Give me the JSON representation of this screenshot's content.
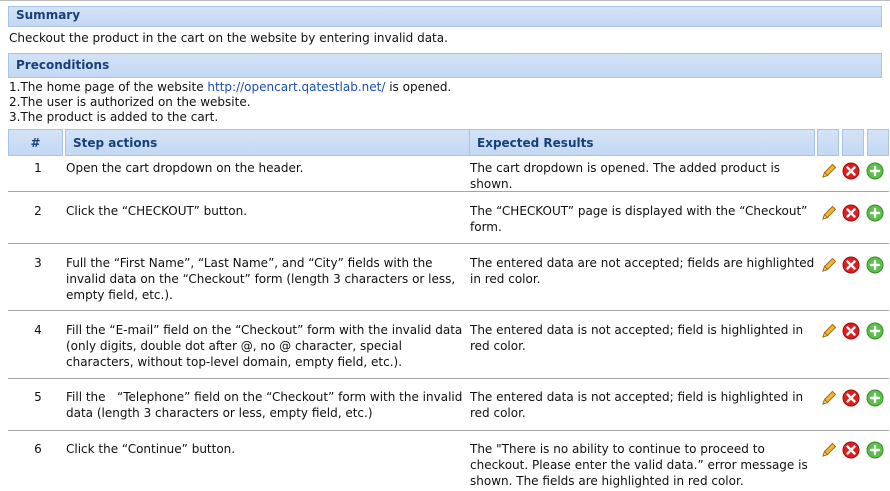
{
  "summary": {
    "heading": "Summary",
    "text": "Checkout the product in the cart on the website by entering invalid data."
  },
  "preconditions": {
    "heading": "Preconditions",
    "line1_prefix": "1.The home page of the website ",
    "line1_link": "http://opencart.qatestlab.net/",
    "line1_suffix": " is opened.",
    "line2": "2.The user is authorized on the website.",
    "line3": "3.The product is added to the cart."
  },
  "steps_table": {
    "col_num": "#",
    "col_actions": "Step actions",
    "col_expected": "Expected Results",
    "rows": [
      {
        "num": "1",
        "action": "Open the cart dropdown on the header.",
        "expected": "The cart dropdown is opened. The added product is shown."
      },
      {
        "num": "2",
        "action": "Click the “CHECKOUT” button.",
        "expected": "The “CHECKOUT” page is displayed with the “Checkout” form."
      },
      {
        "num": "3",
        "action": "Full the “First Name”, “Last Name”, and “City” fields with the invalid data on the “Checkout” form (length 3 characters or less, empty field, etc.).",
        "expected": "The entered data are not accepted; fields are highlighted in red color."
      },
      {
        "num": "4",
        "action": "Fill the “E-mail” field on the “Checkout” form with the invalid data (only digits, double dot after @, no @ character, special characters, without top-level domain, empty field, etc.).",
        "expected": "The entered data is not accepted; field is highlighted in red color."
      },
      {
        "num": "5",
        "action": "Fill the   “Telephone” field on the “Checkout” form with the invalid data (length 3 characters or less, empty field, etc.)",
        "expected": "The entered data is not accepted; field is highlighted in red color."
      },
      {
        "num": "6",
        "action": "Click the “Continue” button.",
        "expected": "The \"There is no ability to continue to proceed to checkout. Please enter the valid data.” error message is shown. The fields are highlighted in red color."
      }
    ]
  },
  "icons": {
    "edit": "pencil-icon",
    "delete": "red-x-delete-icon",
    "add": "green-plus-add-icon"
  }
}
